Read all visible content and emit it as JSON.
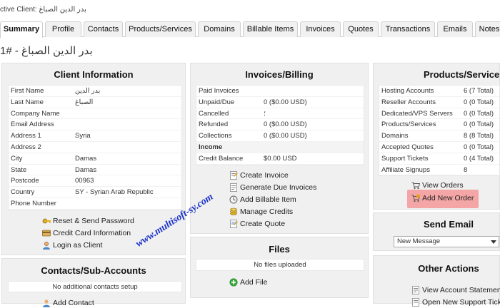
{
  "header": {
    "active_client": "ctive Client: بدر الدين الصباغ",
    "page_title": "بدر الدين الصباغ - #1"
  },
  "tabs": [
    {
      "label": "Summary",
      "active": true
    },
    {
      "label": "Profile"
    },
    {
      "label": "Contacts"
    },
    {
      "label": "Products/Services"
    },
    {
      "label": "Domains"
    },
    {
      "label": "Billable Items"
    },
    {
      "label": "Invoices"
    },
    {
      "label": "Quotes"
    },
    {
      "label": "Transactions"
    },
    {
      "label": "Emails"
    },
    {
      "label": "Notes"
    }
  ],
  "client_info": {
    "title": "Client Information",
    "rows": [
      {
        "label": "First Name",
        "value": "بدر الدين"
      },
      {
        "label": "Last Name",
        "value": "الصباغ"
      },
      {
        "label": "Company Name",
        "value": ""
      },
      {
        "label": "Email Address",
        "value": ""
      },
      {
        "label": "Address 1",
        "value": "Syria"
      },
      {
        "label": "Address 2",
        "value": ""
      },
      {
        "label": "City",
        "value": "Damas"
      },
      {
        "label": "State",
        "value": "Damas"
      },
      {
        "label": "Postcode",
        "value": "00963"
      },
      {
        "label": "Country",
        "value": "SY - Syrian Arab Republic"
      },
      {
        "label": "Phone Number",
        "value": ""
      }
    ],
    "actions": [
      {
        "label": "Reset & Send Password",
        "icon": "key-icon"
      },
      {
        "label": "Credit Card Information",
        "icon": "credit-card-icon"
      },
      {
        "label": "Login as Client",
        "icon": "user-icon"
      }
    ]
  },
  "contacts": {
    "title": "Contacts/Sub-Accounts",
    "empty_text": "No additional contacts setup",
    "add_label": "Add Contact"
  },
  "invoices": {
    "title": "Invoices/Billing",
    "rows": [
      {
        "label": "Paid Invoices",
        "value": ""
      },
      {
        "label": "Unpaid/Due",
        "value": "0 ($0.00 USD)"
      },
      {
        "label": "Cancelled",
        "value": "؛"
      },
      {
        "label": "Refunded",
        "value": "0 ($0.00 USD)"
      },
      {
        "label": "Collections",
        "value": "0 ($0.00 USD)"
      },
      {
        "label": "Income",
        "value": "",
        "bold": true
      },
      {
        "label": "Credit Balance",
        "value": "$0.00 USD"
      }
    ],
    "actions": [
      {
        "label": "Create Invoice",
        "icon": "invoice-icon"
      },
      {
        "label": "Generate Due Invoices",
        "icon": "generate-icon"
      },
      {
        "label": "Add Billable Item",
        "icon": "clock-icon"
      },
      {
        "label": "Manage Credits",
        "icon": "credits-icon"
      },
      {
        "label": "Create Quote",
        "icon": "quote-icon"
      }
    ]
  },
  "files": {
    "title": "Files",
    "empty_text": "No files uploaded",
    "add_label": "Add File"
  },
  "products": {
    "title": "Products/Services",
    "rows": [
      {
        "label": "Hosting Accounts",
        "value": "6 (7 Total)"
      },
      {
        "label": "Reseller Accounts",
        "value": "0 (0 Total)"
      },
      {
        "label": "Dedicated/VPS Servers",
        "value": "0 (0 Total)"
      },
      {
        "label": "Products/Services",
        "value": "0 (0 Total)"
      },
      {
        "label": "Domains",
        "value": "8 (8 Total)"
      },
      {
        "label": "Accepted Quotes",
        "value": "0 (0 Total)"
      },
      {
        "label": "Support Tickets",
        "value": "0 (4 Total)"
      },
      {
        "label": "Affiliate Signups",
        "value": "8"
      }
    ],
    "view_orders": "View Orders",
    "add_new_order": "Add New Order"
  },
  "send_email": {
    "title": "Send Email",
    "selected": "New Message"
  },
  "other_actions": {
    "title": "Other Actions",
    "items": [
      {
        "label": "View Account Statement",
        "icon": "statement-icon"
      },
      {
        "label": "Open New Support Ticket",
        "icon": "ticket-icon"
      }
    ]
  },
  "watermark": "www.multisoft-sy.com",
  "colors": {
    "highlight": "#f4a5a5",
    "panel": "#f0f0f0",
    "watermark": "#1a31c9"
  }
}
